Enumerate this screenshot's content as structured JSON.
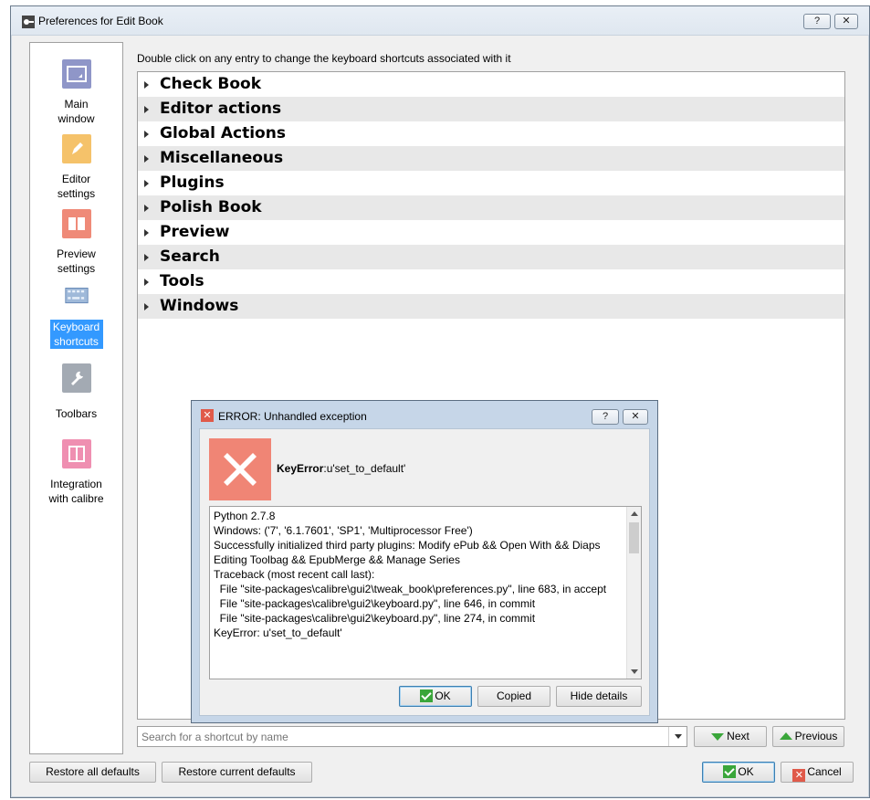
{
  "window": {
    "title": "Preferences for Edit Book",
    "help_btn": "?",
    "close_btn": "✕"
  },
  "sidebar": {
    "items": [
      {
        "label": "Main window",
        "color": "#8f96c8"
      },
      {
        "label": "Editor settings",
        "color": "#f5c26a"
      },
      {
        "label": "Preview settings",
        "color": "#ef8a78"
      },
      {
        "label": "Keyboard shortcuts",
        "color": "#9fb9d9",
        "selected": true
      },
      {
        "label": "Toolbars",
        "color": "#a3aab3"
      },
      {
        "label": "Integration with calibre",
        "color": "#ef8fb1"
      }
    ]
  },
  "main": {
    "hint": "Double click on any entry to change the keyboard shortcuts associated with it",
    "tree": [
      "Check Book",
      "Editor actions",
      "Global Actions",
      "Miscellaneous",
      "Plugins",
      "Polish Book",
      "Preview",
      "Search",
      "Tools",
      "Windows"
    ],
    "search_placeholder": "Search for a shortcut by name",
    "next_label": "Next",
    "previous_label": "Previous"
  },
  "footer": {
    "restore_all": "Restore all defaults",
    "restore_current": "Restore current defaults",
    "ok": "OK",
    "cancel": "Cancel"
  },
  "error_dialog": {
    "title": "ERROR: Unhandled exception",
    "help_btn": "?",
    "close_btn": "✕",
    "error_type": "KeyError",
    "error_msg": ":u'set_to_default'",
    "details": "Python 2.7.8\nWindows: ('7', '6.1.7601', 'SP1', 'Multiprocessor Free')\nSuccessfully initialized third party plugins: Modify ePub && Open With && Diaps Editing Toolbag && EpubMerge && Manage Series\nTraceback (most recent call last):\n  File \"site-packages\\calibre\\gui2\\tweak_book\\preferences.py\", line 683, in accept\n  File \"site-packages\\calibre\\gui2\\keyboard.py\", line 646, in commit\n  File \"site-packages\\calibre\\gui2\\keyboard.py\", line 274, in commit\nKeyError: u'set_to_default'",
    "ok": "OK",
    "copied": "Copied",
    "hide_details": "Hide details"
  }
}
